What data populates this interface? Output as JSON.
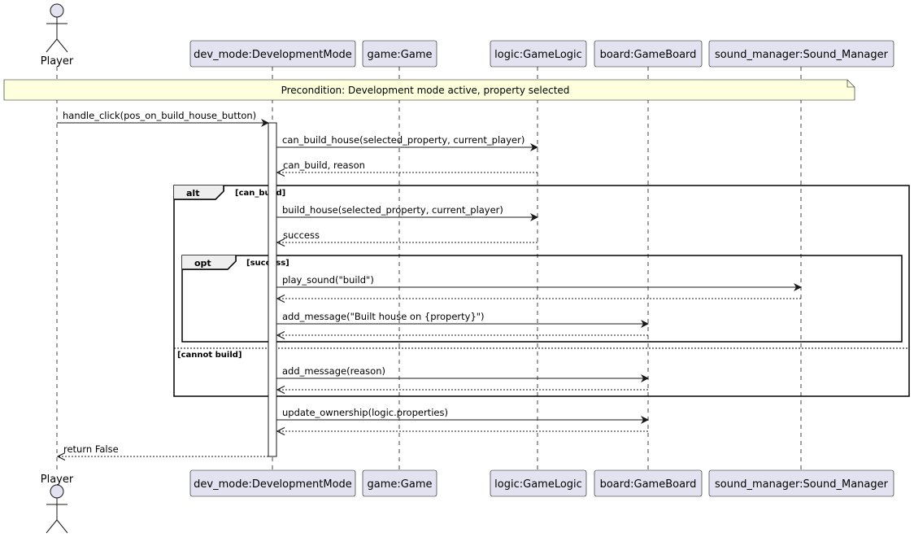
{
  "note": {
    "text": "Precondition: Development mode active, property selected",
    "fill": "#FEFFDD",
    "stroke": "#181818"
  },
  "colors": {
    "participant_fill": "#E2E2F0",
    "participant_stroke": "#181818",
    "activation_fill": "#FFFFFF"
  },
  "participants": [
    {
      "id": "player",
      "label": "Player",
      "kind": "actor"
    },
    {
      "id": "dev_mode",
      "label": "dev_mode:DevelopmentMode",
      "kind": "box"
    },
    {
      "id": "game",
      "label": "game:Game",
      "kind": "box"
    },
    {
      "id": "logic",
      "label": "logic:GameLogic",
      "kind": "box"
    },
    {
      "id": "board",
      "label": "board:GameBoard",
      "kind": "box"
    },
    {
      "id": "sound",
      "label": "sound_manager:Sound_Manager",
      "kind": "box"
    }
  ],
  "frames": [
    {
      "id": "alt",
      "keyword": "alt",
      "guard": "[can_build]",
      "else_guard": "[cannot build]"
    },
    {
      "id": "opt",
      "keyword": "opt",
      "guard": "[success]"
    }
  ],
  "messages": [
    {
      "from": "player",
      "to": "dev_mode",
      "text": "handle_click(pos_on_build_house_button)",
      "kind": "sync"
    },
    {
      "from": "dev_mode",
      "to": "logic",
      "text": "can_build_house(selected_property, current_player)",
      "kind": "sync"
    },
    {
      "from": "logic",
      "to": "dev_mode",
      "text": "can_build, reason",
      "kind": "return"
    },
    {
      "from": "dev_mode",
      "to": "logic",
      "text": "build_house(selected_property, current_player)",
      "kind": "sync"
    },
    {
      "from": "logic",
      "to": "dev_mode",
      "text": "success",
      "kind": "return"
    },
    {
      "from": "dev_mode",
      "to": "sound",
      "text": "play_sound(\"build\")",
      "kind": "sync"
    },
    {
      "from": "sound",
      "to": "dev_mode",
      "text": "",
      "kind": "return"
    },
    {
      "from": "dev_mode",
      "to": "board",
      "text": "add_message(\"Built house on {property}\")",
      "kind": "sync"
    },
    {
      "from": "board",
      "to": "dev_mode",
      "text": "",
      "kind": "return"
    },
    {
      "from": "dev_mode",
      "to": "board",
      "text": "add_message(reason)",
      "kind": "sync"
    },
    {
      "from": "board",
      "to": "dev_mode",
      "text": "",
      "kind": "return"
    },
    {
      "from": "dev_mode",
      "to": "board",
      "text": "update_ownership(logic.properties)",
      "kind": "sync"
    },
    {
      "from": "board",
      "to": "dev_mode",
      "text": "",
      "kind": "return"
    },
    {
      "from": "dev_mode",
      "to": "player",
      "text": "return False",
      "kind": "return"
    }
  ]
}
